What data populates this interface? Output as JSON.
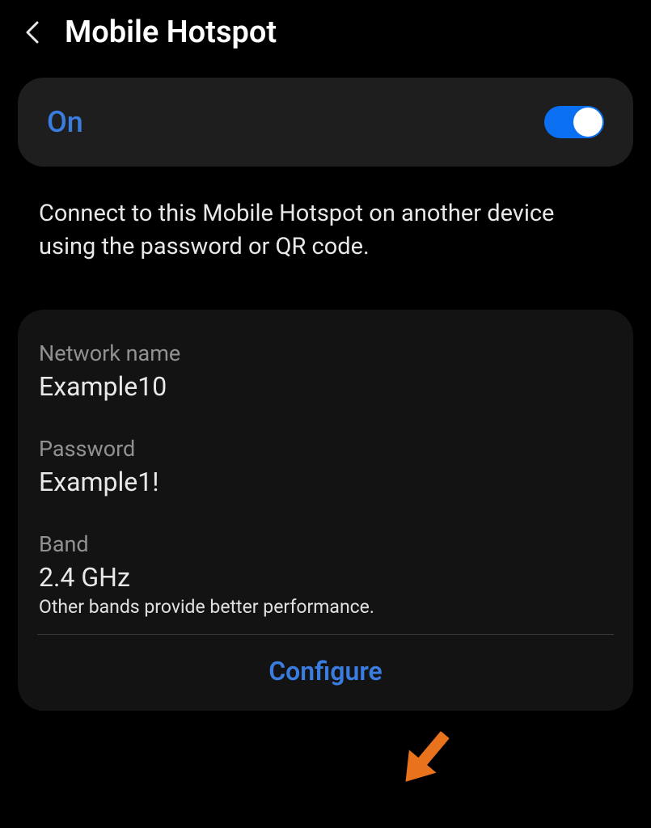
{
  "header": {
    "title": "Mobile Hotspot"
  },
  "toggle": {
    "state_label": "On",
    "enabled": true
  },
  "description": "Connect to this Mobile Hotspot on another device using the password or QR code.",
  "details": {
    "network_name": {
      "label": "Network name",
      "value": "Example10"
    },
    "password": {
      "label": "Password",
      "value": "Example1!"
    },
    "band": {
      "label": "Band",
      "value": "2.4 GHz",
      "hint": "Other bands provide better performance."
    }
  },
  "configure_label": "Configure"
}
